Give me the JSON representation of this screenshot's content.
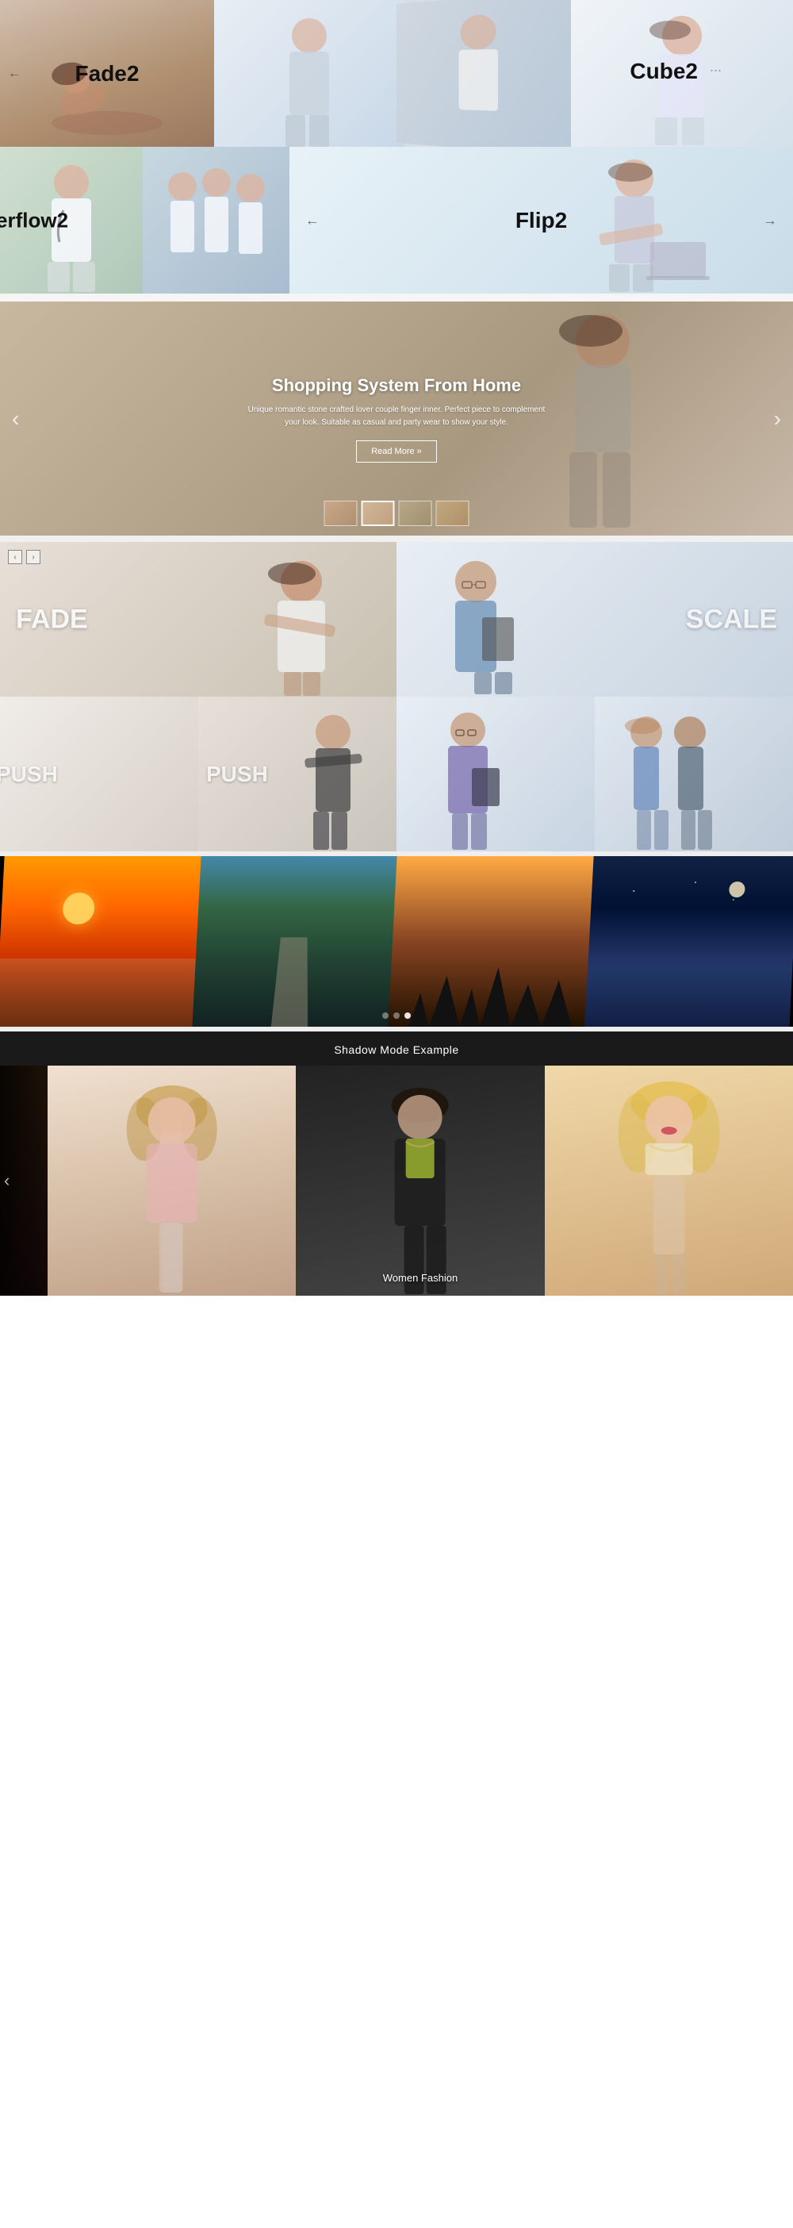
{
  "section1": {
    "row1": {
      "panel1": {
        "label": "Fade2",
        "arrow_left": "←"
      },
      "panel2": {
        "label": "Cube2",
        "arrow_right": "..."
      }
    },
    "row2": {
      "panel1": {
        "label": "erflow2"
      },
      "panel2": {
        "label": "Flip2",
        "arrow_left": "←",
        "arrow_right": "→"
      }
    }
  },
  "hero": {
    "title": "Shopping System From Home",
    "description": "Unique romantic stone crafted lover couple finger inner. Perfect piece to complement your look. Suitable as casual and party wear to show your style.",
    "button_label": "Read More »",
    "arrow_left": "‹",
    "arrow_right": "›"
  },
  "effects": {
    "panel1_label": "FADE",
    "panel2_label": "SCALE",
    "panel3_label": "PUSH",
    "panel4_label": "PUSH"
  },
  "landscape": {
    "dots": [
      {
        "active": false
      },
      {
        "active": false
      },
      {
        "active": true
      }
    ]
  },
  "shadow": {
    "title": "Shadow Mode Example",
    "caption": "Women Fashion",
    "nav_arrow": "‹"
  }
}
